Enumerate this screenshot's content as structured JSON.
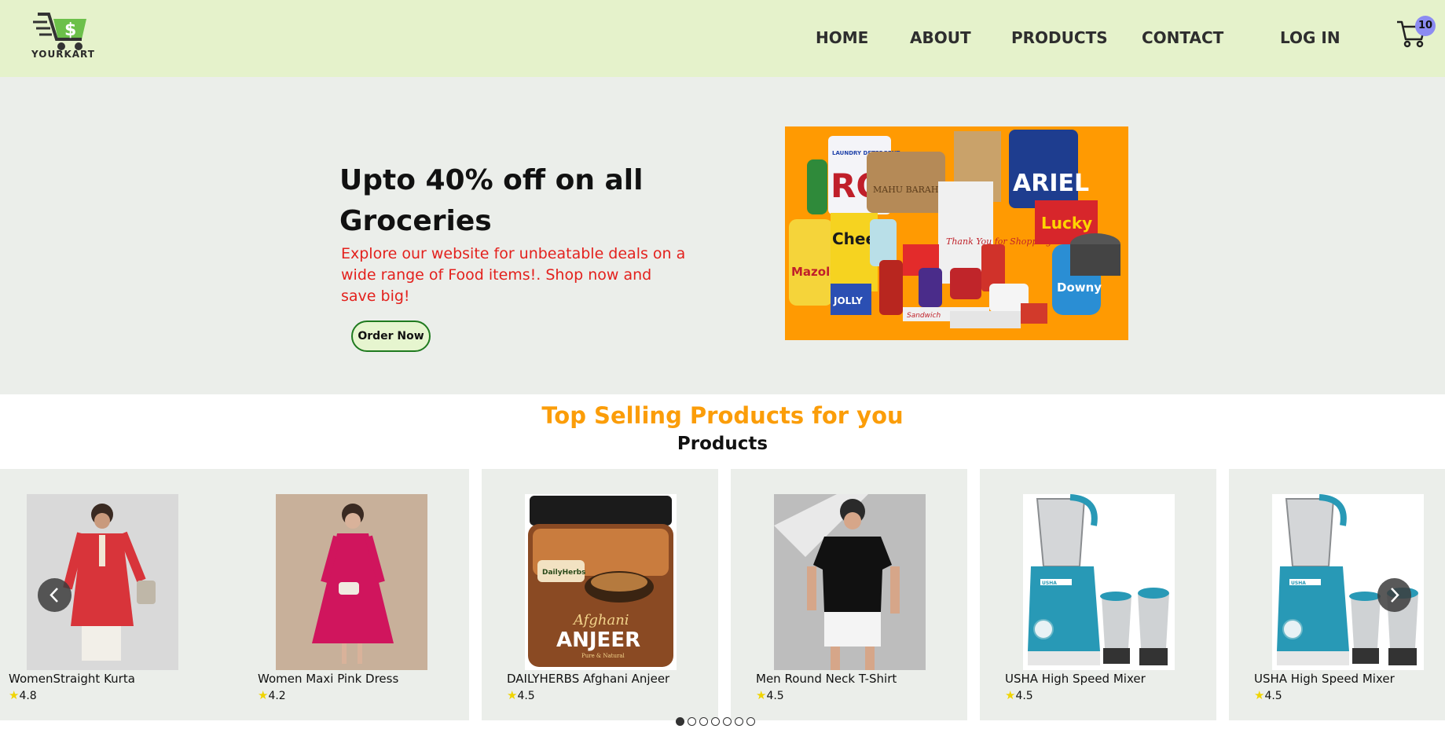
{
  "nav": {
    "logo_text": "YOURKART",
    "links": [
      "HOME",
      "ABOUT",
      "PRODUCTS",
      "CONTACT"
    ],
    "login": "LOG IN",
    "cart_count": "10",
    "icons": {
      "cart": "cart-icon",
      "logo": "logo-cart-icon"
    }
  },
  "hero": {
    "title": "Upto 40% off on all Groceries",
    "subtitle": "Explore our website for unbeatable deals on a wide range of Food items!. Shop now and save big!",
    "cta": "Order Now",
    "image_packaging_text": [
      "ROL",
      "ARIEL",
      "Lucky",
      "Cheer",
      "Mazola",
      "JOLLY",
      "Downy",
      "Thank You for Shopping",
      "MAHU BARAH",
      "LAUNDRY DETERGENT",
      "Sandwich"
    ]
  },
  "products_section": {
    "title": "Top Selling Products for you",
    "subtitle": "Products",
    "items": [
      {
        "name": "WomenStraight Kurta",
        "rating": "4.8"
      },
      {
        "name": "Women Maxi Pink Dress",
        "rating": "4.2"
      },
      {
        "name": "DAILYHERBS Afghani Anjeer",
        "rating": "4.5",
        "label_text": [
          "DailyHerbs",
          "Afghani",
          "ANJEER",
          "Pure & Natural"
        ]
      },
      {
        "name": "Men Round Neck T-Shirt",
        "rating": "4.5"
      },
      {
        "name": "USHA High Speed Mixer",
        "rating": "4.5",
        "label_text": [
          "USHA"
        ]
      },
      {
        "name": "USHA High Speed Mixer",
        "rating": "4.5",
        "label_text": [
          "USHA"
        ]
      }
    ],
    "dots_total": 7,
    "dots_active": 0
  },
  "colors": {
    "nav_bg": "#e5f2cb",
    "hero_bg": "#ebeeea",
    "accent_orange": "#fb9d09",
    "subtitle_red": "#e3211d",
    "badge": "#8c8cf2",
    "cta_border": "#1f7a1f"
  }
}
